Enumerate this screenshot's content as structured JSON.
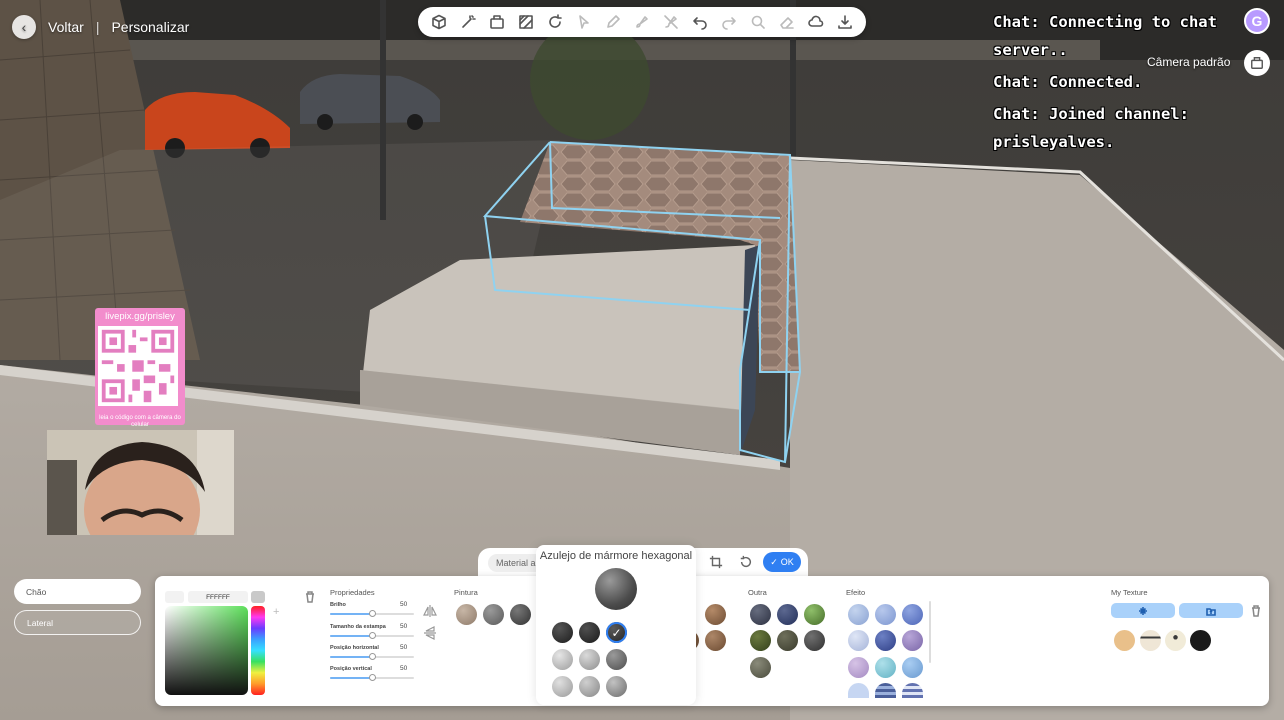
{
  "nav": {
    "back_label": "Voltar",
    "separator": "|",
    "customize_label": "Personalizar"
  },
  "toolbar": {
    "icons": [
      "cube-icon",
      "magic-wand-icon",
      "camera-fill-icon",
      "hatch-pattern-icon",
      "rotate-icon",
      "pointer-icon",
      "pen-icon",
      "paint-icon",
      "paint-erase-icon",
      "undo-icon",
      "redo-icon",
      "zoom-icon",
      "eraser-icon",
      "cloud-icon",
      "download-icon"
    ]
  },
  "chat": {
    "lines": [
      "Chat: Connecting to chat server..",
      "Chat: Connected.",
      "Chat: Joined channel: prisleyalves."
    ]
  },
  "user": {
    "avatar_letter": "G",
    "avatar_color": "#b89aff"
  },
  "camera": {
    "label": "Câmera padrão"
  },
  "qr": {
    "title": "livepix.gg/prisley",
    "caption": "leia o código com a câmera do celular"
  },
  "faces": {
    "active": "Chão",
    "inactive": "Lateral"
  },
  "panel": {
    "material_tab": "Material al",
    "ok_label": "OK",
    "popup_title": "Azulejo de mármore hexagonal",
    "color_hex": "FFFFFF",
    "properties_title": "Propriedades",
    "properties": [
      {
        "label": "Brilho",
        "value": "50",
        "fraction": 0.5
      },
      {
        "label": "Tamanho da estampa",
        "value": "50",
        "fraction": 0.5
      },
      {
        "label": "Posição horizontal",
        "value": "50",
        "fraction": 0.5
      },
      {
        "label": "Posição vertical",
        "value": "50",
        "fraction": 0.5
      }
    ],
    "sections": {
      "pintura": "Pintura",
      "outra": "Outra",
      "efeito": "Efeito",
      "my_texture": "My Texture"
    }
  },
  "colors": {
    "accent": "#2f7ff2",
    "tab_active_bg": "#ffffff",
    "qr_pink": "#f28ccc"
  }
}
